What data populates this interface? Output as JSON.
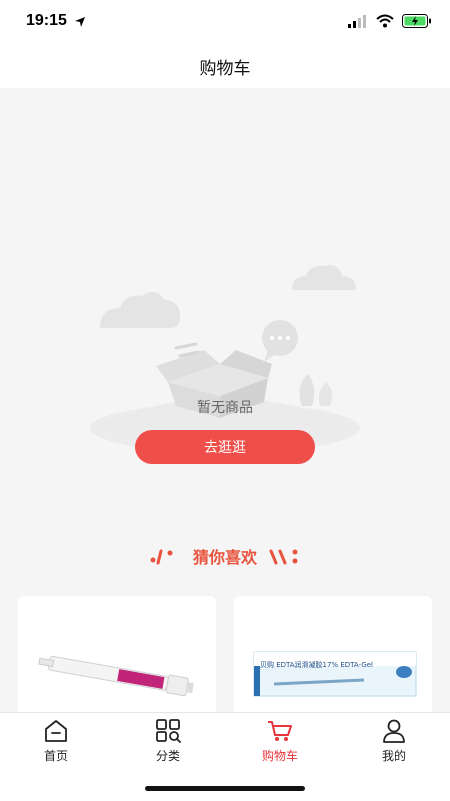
{
  "status_bar": {
    "time": "19:15"
  },
  "nav": {
    "title": "购物车"
  },
  "empty_state": {
    "message": "暂无商品",
    "button_label": "去逛逛"
  },
  "recommend": {
    "title": "猜你喜欢"
  },
  "products": [
    {
      "image_text": ""
    },
    {
      "image_text": "贝购  EDTA润滑凝胶17%  EDTA-Gel"
    }
  ],
  "tabs": [
    {
      "label": "首页",
      "icon": "home-icon",
      "active": false
    },
    {
      "label": "分类",
      "icon": "category-icon",
      "active": false
    },
    {
      "label": "购物车",
      "icon": "cart-icon",
      "active": true
    },
    {
      "label": "我的",
      "icon": "user-icon",
      "active": false
    }
  ],
  "colors": {
    "accent": "#ef4f4a",
    "tab_active": "#e8343b",
    "background": "#f5f5f5"
  }
}
